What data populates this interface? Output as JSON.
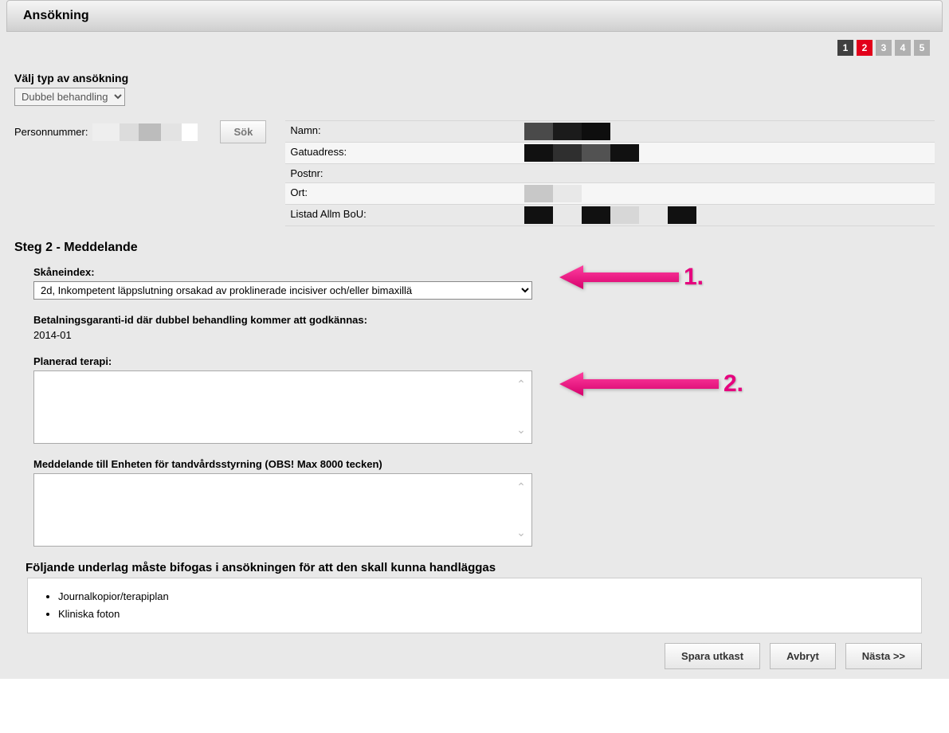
{
  "header": {
    "title": "Ansökning"
  },
  "steps": [
    {
      "n": "1",
      "state": "done"
    },
    {
      "n": "2",
      "state": "active"
    },
    {
      "n": "3",
      "state": ""
    },
    {
      "n": "4",
      "state": ""
    },
    {
      "n": "5",
      "state": ""
    }
  ],
  "type_section": {
    "label": "Välj typ av ansökning",
    "selected": "Dubbel behandling"
  },
  "person": {
    "pn_label": "Personnummer:",
    "search_btn": "Sök",
    "rows": [
      {
        "label": "Namn:"
      },
      {
        "label": "Gatuadress:"
      },
      {
        "label": "Postnr:"
      },
      {
        "label": "Ort:"
      },
      {
        "label": "Listad Allm BoU:"
      }
    ]
  },
  "step_heading": "Steg 2 - Meddelande",
  "skaneindex": {
    "label": "Skåneindex:",
    "selected": "2d, Inkompetent läppslutning orsakad av proklinerade incisiver och/eller bimaxillä"
  },
  "betalnings": {
    "label": "Betalningsgaranti-id där dubbel behandling kommer att godkännas:",
    "value": "2014-01"
  },
  "planerad": {
    "label": "Planerad terapi:",
    "value": ""
  },
  "meddelande": {
    "label": "Meddelande till Enheten för tandvårdsstyrning (OBS! Max 8000 tecken)",
    "value": ""
  },
  "attachments": {
    "heading": "Följande underlag måste bifogas i ansökningen för att den skall kunna handläggas",
    "items": [
      "Journalkopior/terapiplan",
      "Kliniska foton"
    ]
  },
  "buttons": {
    "save": "Spara utkast",
    "cancel": "Avbryt",
    "next": "Nästa >>"
  },
  "callouts": {
    "one": "1.",
    "two": "2."
  }
}
